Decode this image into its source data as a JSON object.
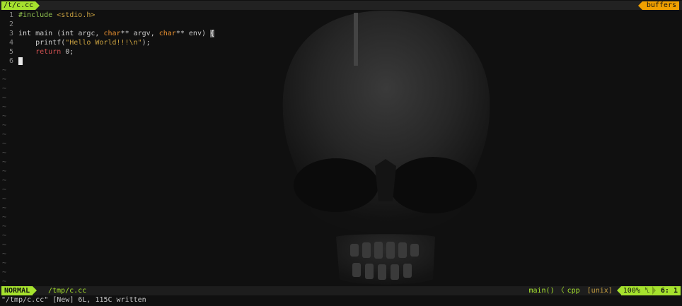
{
  "tabline": {
    "active_tab": "/t/c.cc",
    "buffers_label": "buffers"
  },
  "code_lines": [
    {
      "num": "1"
    },
    {
      "num": "2"
    },
    {
      "num": "3"
    },
    {
      "num": "4"
    },
    {
      "num": "5"
    },
    {
      "num": "6"
    }
  ],
  "code": {
    "include_directive": "#include",
    "include_header": "<stdio.h>",
    "int_kw": "int",
    "main_decl": "main (",
    "int_kw2": "int",
    "argc": "argc,",
    "char_kw": "char",
    "argv": "** argv,",
    "char_kw2": "char",
    "env": "** env)",
    "brace": "{",
    "printf_call": "printf(",
    "printf_string": "\"Hello World!!!\\n\"",
    "printf_end": ");",
    "return_kw": "return",
    "return_val": "0;"
  },
  "empty_line_marker": "~",
  "statusline": {
    "mode": "NORMAL",
    "file_path": "/tmp/c.cc",
    "function": "main()",
    "separator": "〈",
    "filetype": "cpp",
    "fileformat": "[unix]",
    "percent": "100%",
    "line_icon": "␤",
    "position": "6:  1"
  },
  "message": "\"/tmp/c.cc\" [New] 6L, 115C written",
  "colors": {
    "accent": "#a6e22e",
    "buffers": "#f0a000",
    "background": "#101010"
  },
  "icons": {
    "cursor": "block-cursor",
    "wallpaper": "skull-wallpaper"
  }
}
